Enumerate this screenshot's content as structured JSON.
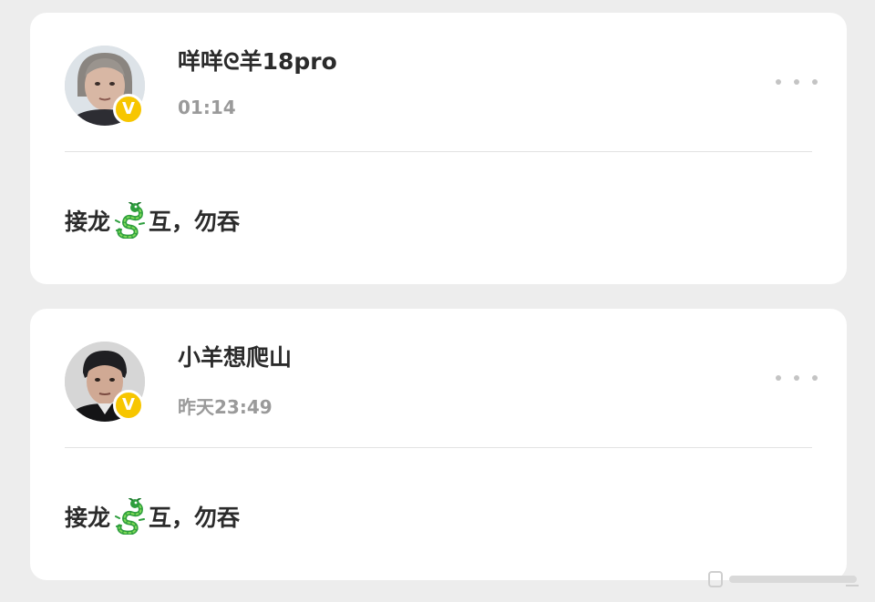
{
  "posts": [
    {
      "username": "咩咩ᘓ羊18pro",
      "time": "01:14",
      "badge": "V",
      "avatar_icon": "user-avatar-woman",
      "content_before": "接龙",
      "content_emoji_icon": "dragon-emoji-icon",
      "content_after": "互，勿吞"
    },
    {
      "username": "小羊想爬山",
      "time": "昨天23:49",
      "badge": "V",
      "avatar_icon": "user-avatar-man",
      "content_before": "接龙",
      "content_emoji_icon": "dragon-emoji-icon",
      "content_after": "互，勿吞"
    }
  ],
  "colors": {
    "background": "#ededed",
    "card": "#ffffff",
    "badge": "#f7c600",
    "username": "#2b2b2b",
    "timestamp": "#9a9a9a"
  }
}
